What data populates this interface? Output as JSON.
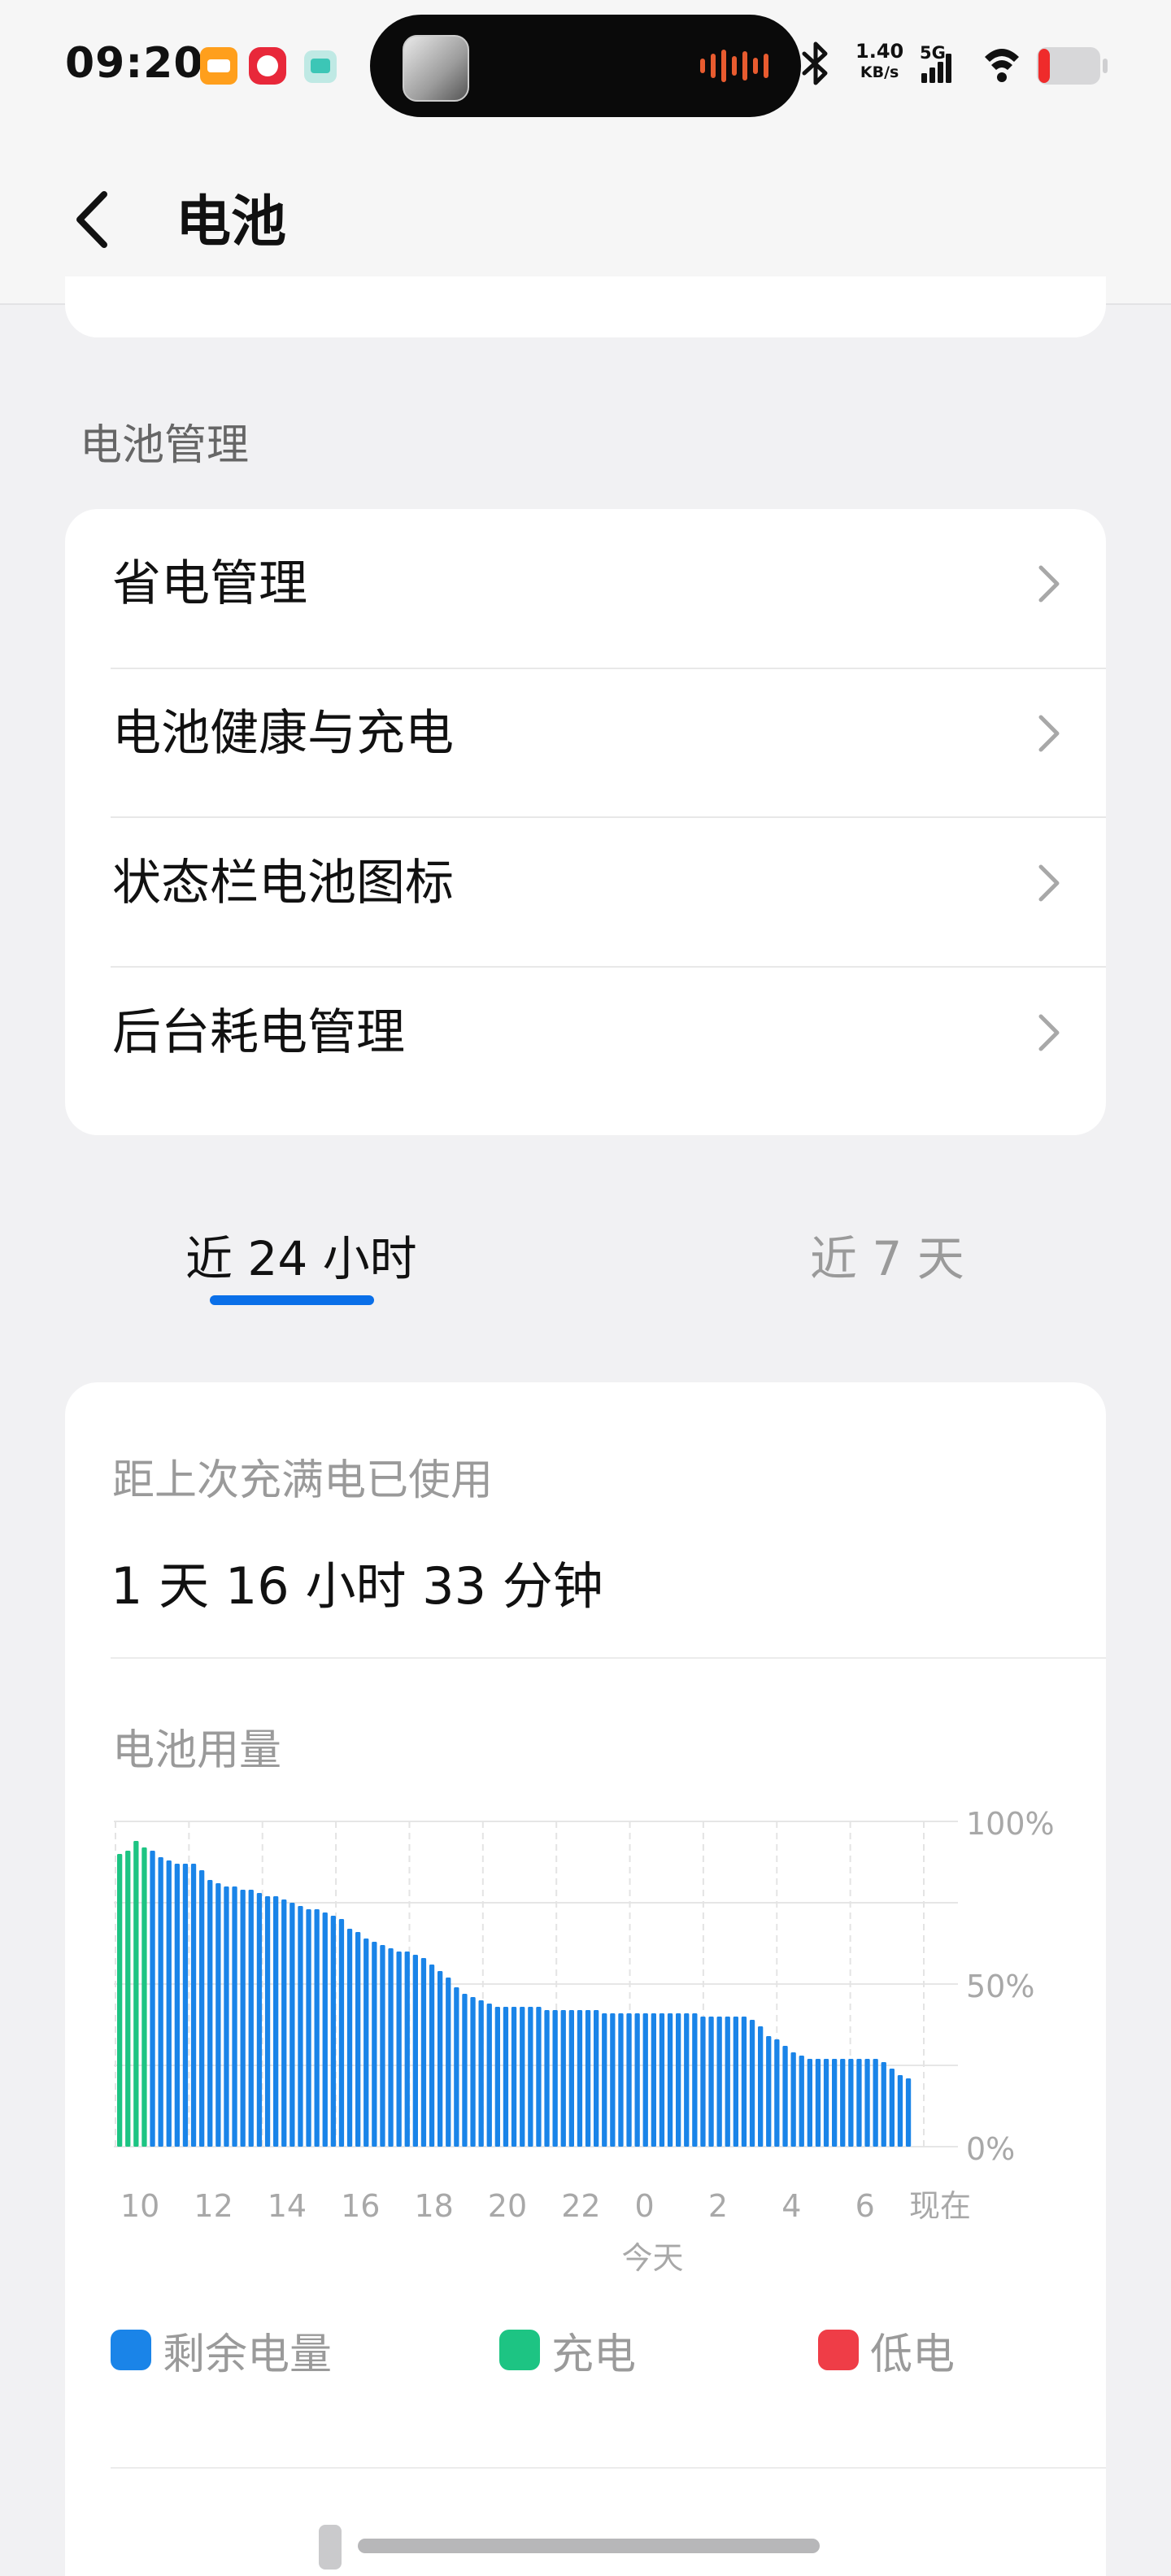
{
  "status_bar": {
    "time": "09:20",
    "net_speed_value": "1.40",
    "net_speed_unit": "KB/s",
    "network_type": "5G",
    "icons": [
      "notification-app-icon",
      "notification-app-icon",
      "notification-app-icon",
      "bluetooth-icon",
      "signal-icon",
      "wifi-icon",
      "battery-low-icon"
    ]
  },
  "header": {
    "title": "电池"
  },
  "battery_management": {
    "section_title": "电池管理",
    "items": [
      {
        "label": "省电管理"
      },
      {
        "label": "电池健康与充电"
      },
      {
        "label": "状态栏电池图标"
      },
      {
        "label": "后台耗电管理"
      }
    ]
  },
  "tabs": [
    {
      "label": "近 24 小时",
      "selected": true
    },
    {
      "label": "近 7 天",
      "selected": false
    }
  ],
  "usage": {
    "since_label": "距上次充满电已使用",
    "since_value": "1 天 16 小时 33 分钟",
    "chart_title": "电池用量"
  },
  "chart_data": {
    "type": "bar",
    "title": "电池用量",
    "y_tick_labels": [
      "100%",
      "50%",
      "0%"
    ],
    "ylim": [
      0,
      100
    ],
    "x_tick_labels": [
      "10",
      "12",
      "14",
      "16",
      "18",
      "20",
      "22",
      "0",
      "2",
      "4",
      "6",
      "现在"
    ],
    "x_sublabel": "今天",
    "grid": true,
    "series": [
      {
        "name": "充电",
        "color": "#1dc483",
        "values": [
          90,
          91,
          94,
          92
        ]
      },
      {
        "name": "剩余电量",
        "color": "#1a84e8",
        "values": [
          91,
          89,
          88,
          87,
          87,
          87,
          85,
          82,
          81,
          80,
          80,
          79,
          79,
          78,
          77,
          77,
          76,
          75,
          74,
          73,
          73,
          72,
          71,
          70,
          67,
          66,
          64,
          63,
          62,
          61,
          60,
          60,
          59,
          58,
          56,
          54,
          52,
          49,
          47,
          46,
          45,
          44,
          43,
          43,
          43,
          43,
          43,
          43,
          42,
          42,
          42,
          42,
          42,
          42,
          42,
          41,
          41,
          41,
          41,
          41,
          41,
          41,
          41,
          41,
          41,
          41,
          41,
          40,
          40,
          40,
          40,
          40,
          40,
          39,
          37,
          34,
          33,
          31,
          29,
          28,
          27,
          27,
          27,
          27,
          27,
          27,
          27,
          27,
          27,
          26,
          24,
          22,
          21
        ]
      }
    ],
    "legend": [
      {
        "name": "剩余电量",
        "color": "#1a84e8"
      },
      {
        "name": "充电",
        "color": "#1dc483"
      },
      {
        "name": "低电",
        "color": "#ef3d47"
      }
    ],
    "legend_position": "bottom"
  }
}
